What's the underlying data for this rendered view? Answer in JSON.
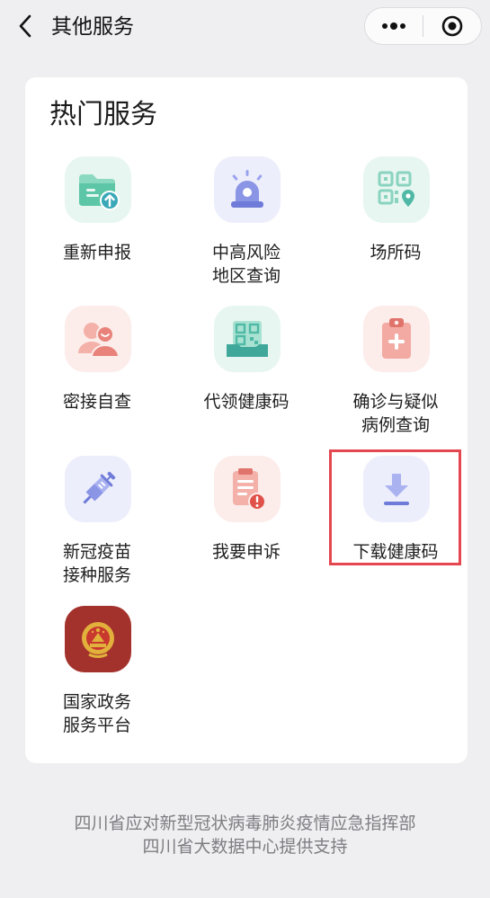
{
  "nav": {
    "title": "其他服务"
  },
  "section": {
    "title": "热门服务"
  },
  "services": [
    {
      "label": "重新申报",
      "icon": "folder-upload-icon"
    },
    {
      "label": "中高风险\n地区查询",
      "icon": "alarm-light-icon"
    },
    {
      "label": "场所码",
      "icon": "qr-location-icon"
    },
    {
      "label": "密接自查",
      "icon": "contacts-icon"
    },
    {
      "label": "代领健康码",
      "icon": "qr-hand-icon"
    },
    {
      "label": "确诊与疑似\n病例查询",
      "icon": "medical-clipboard-icon"
    },
    {
      "label": "新冠疫苗\n接种服务",
      "icon": "syringe-icon"
    },
    {
      "label": "我要申诉",
      "icon": "complaint-doc-icon"
    },
    {
      "label": "下载健康码",
      "icon": "download-icon"
    },
    {
      "label": "国家政务\n服务平台",
      "icon": "national-emblem-icon"
    }
  ],
  "footer": {
    "line1": "四川省应对新型冠状病毒肺炎疫情应急指挥部",
    "line2": "四川省大数据中心提供支持"
  },
  "colors": {
    "teal": "#55c4a5",
    "blue": "#8a95e6",
    "red": "#e8827a",
    "highlight": "#e4474f"
  }
}
